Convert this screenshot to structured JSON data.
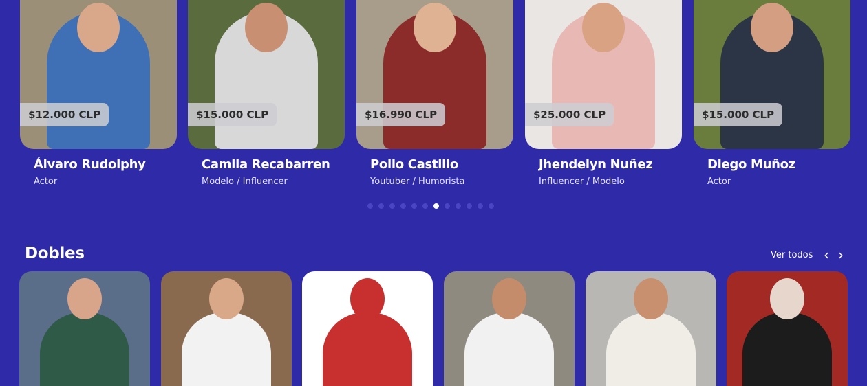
{
  "featured": {
    "cards": [
      {
        "name": "Álvaro Rudolphy",
        "role": "Actor",
        "price": "$12.000 CLP",
        "bg": "#9c8f78",
        "shirt": "#3f6fb5",
        "skin": "#d9a88a"
      },
      {
        "name": "Camila Recabarren",
        "role": "Modelo / Influencer",
        "price": "$15.000 CLP",
        "bg": "#5a6b3e",
        "shirt": "#d8d8d8",
        "skin": "#c98f72"
      },
      {
        "name": "Pollo Castillo",
        "role": "Youtuber / Humorista",
        "price": "$16.990 CLP",
        "bg": "#a89d8a",
        "shirt": "#8b2c2a",
        "skin": "#e0b294"
      },
      {
        "name": "Jhendelyn Nuñez",
        "role": "Influencer / Modelo",
        "price": "$25.000 CLP",
        "bg": "#e9e6e4",
        "shirt": "#e8b9b4",
        "skin": "#d8a283"
      },
      {
        "name": "Diego Muñoz",
        "role": "Actor",
        "price": "$15.000 CLP",
        "bg": "#6a7d3c",
        "shirt": "#2b3546",
        "skin": "#d39e82"
      }
    ],
    "dots_total": 12,
    "dots_active": 6
  },
  "dobles": {
    "title": "Dobles",
    "ver_todos": "Ver todos",
    "prev_icon": "chevron-left-icon",
    "next_icon": "chevron-right-icon",
    "cards": [
      {
        "bg": "#5a6e8a",
        "shirt": "#2f5a48",
        "skin": "#d9a58a"
      },
      {
        "bg": "#8a6a4e",
        "shirt": "#f2f2f2",
        "skin": "#d8a888"
      },
      {
        "bg": "#ffffff",
        "shirt": "#c7302e",
        "skin": "#c7302e"
      },
      {
        "bg": "#8f8a80",
        "shirt": "#f1f1f1",
        "skin": "#c48c6a"
      },
      {
        "bg": "#b9b7b4",
        "shirt": "#f0ece6",
        "skin": "#c8906e"
      },
      {
        "bg": "#a32a24",
        "shirt": "#1c1c1c",
        "skin": "#e7d6cb"
      }
    ]
  }
}
